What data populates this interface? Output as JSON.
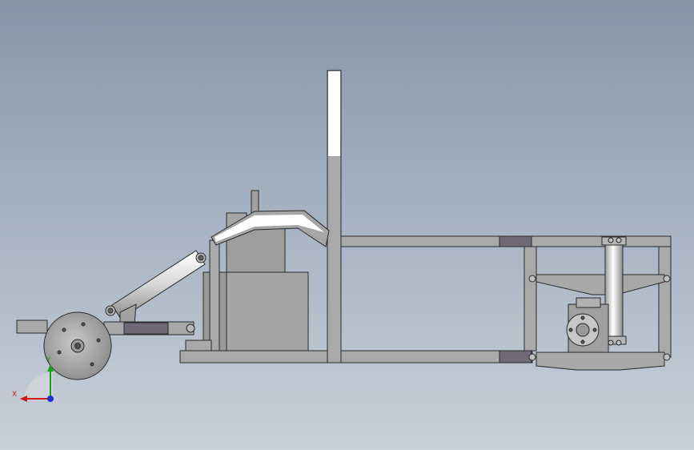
{
  "viewport": {
    "background_top": "#8795a8",
    "background_bottom": "#c8d0da"
  },
  "model": {
    "frame_color": "#a8a8a8",
    "frame_edge": "#303030",
    "shadow_color": "#6a6a74",
    "highlight_color": "#ffffff",
    "parts": [
      "rear-frame-rail",
      "lower-frame-rail",
      "upper-frame-rail",
      "seat-back-post",
      "seat-mount-block",
      "engine-block",
      "seat-bracket",
      "steering-cylinder",
      "front-wheel",
      "front-axle-arm",
      "rear-suspension-assembly",
      "rear-hub",
      "rear-shock-absorber"
    ]
  },
  "triad": {
    "x_label": "X",
    "y_label": "Y",
    "x_color": "#d01818",
    "y_color": "#18a018",
    "z_color": "#1830d0"
  }
}
